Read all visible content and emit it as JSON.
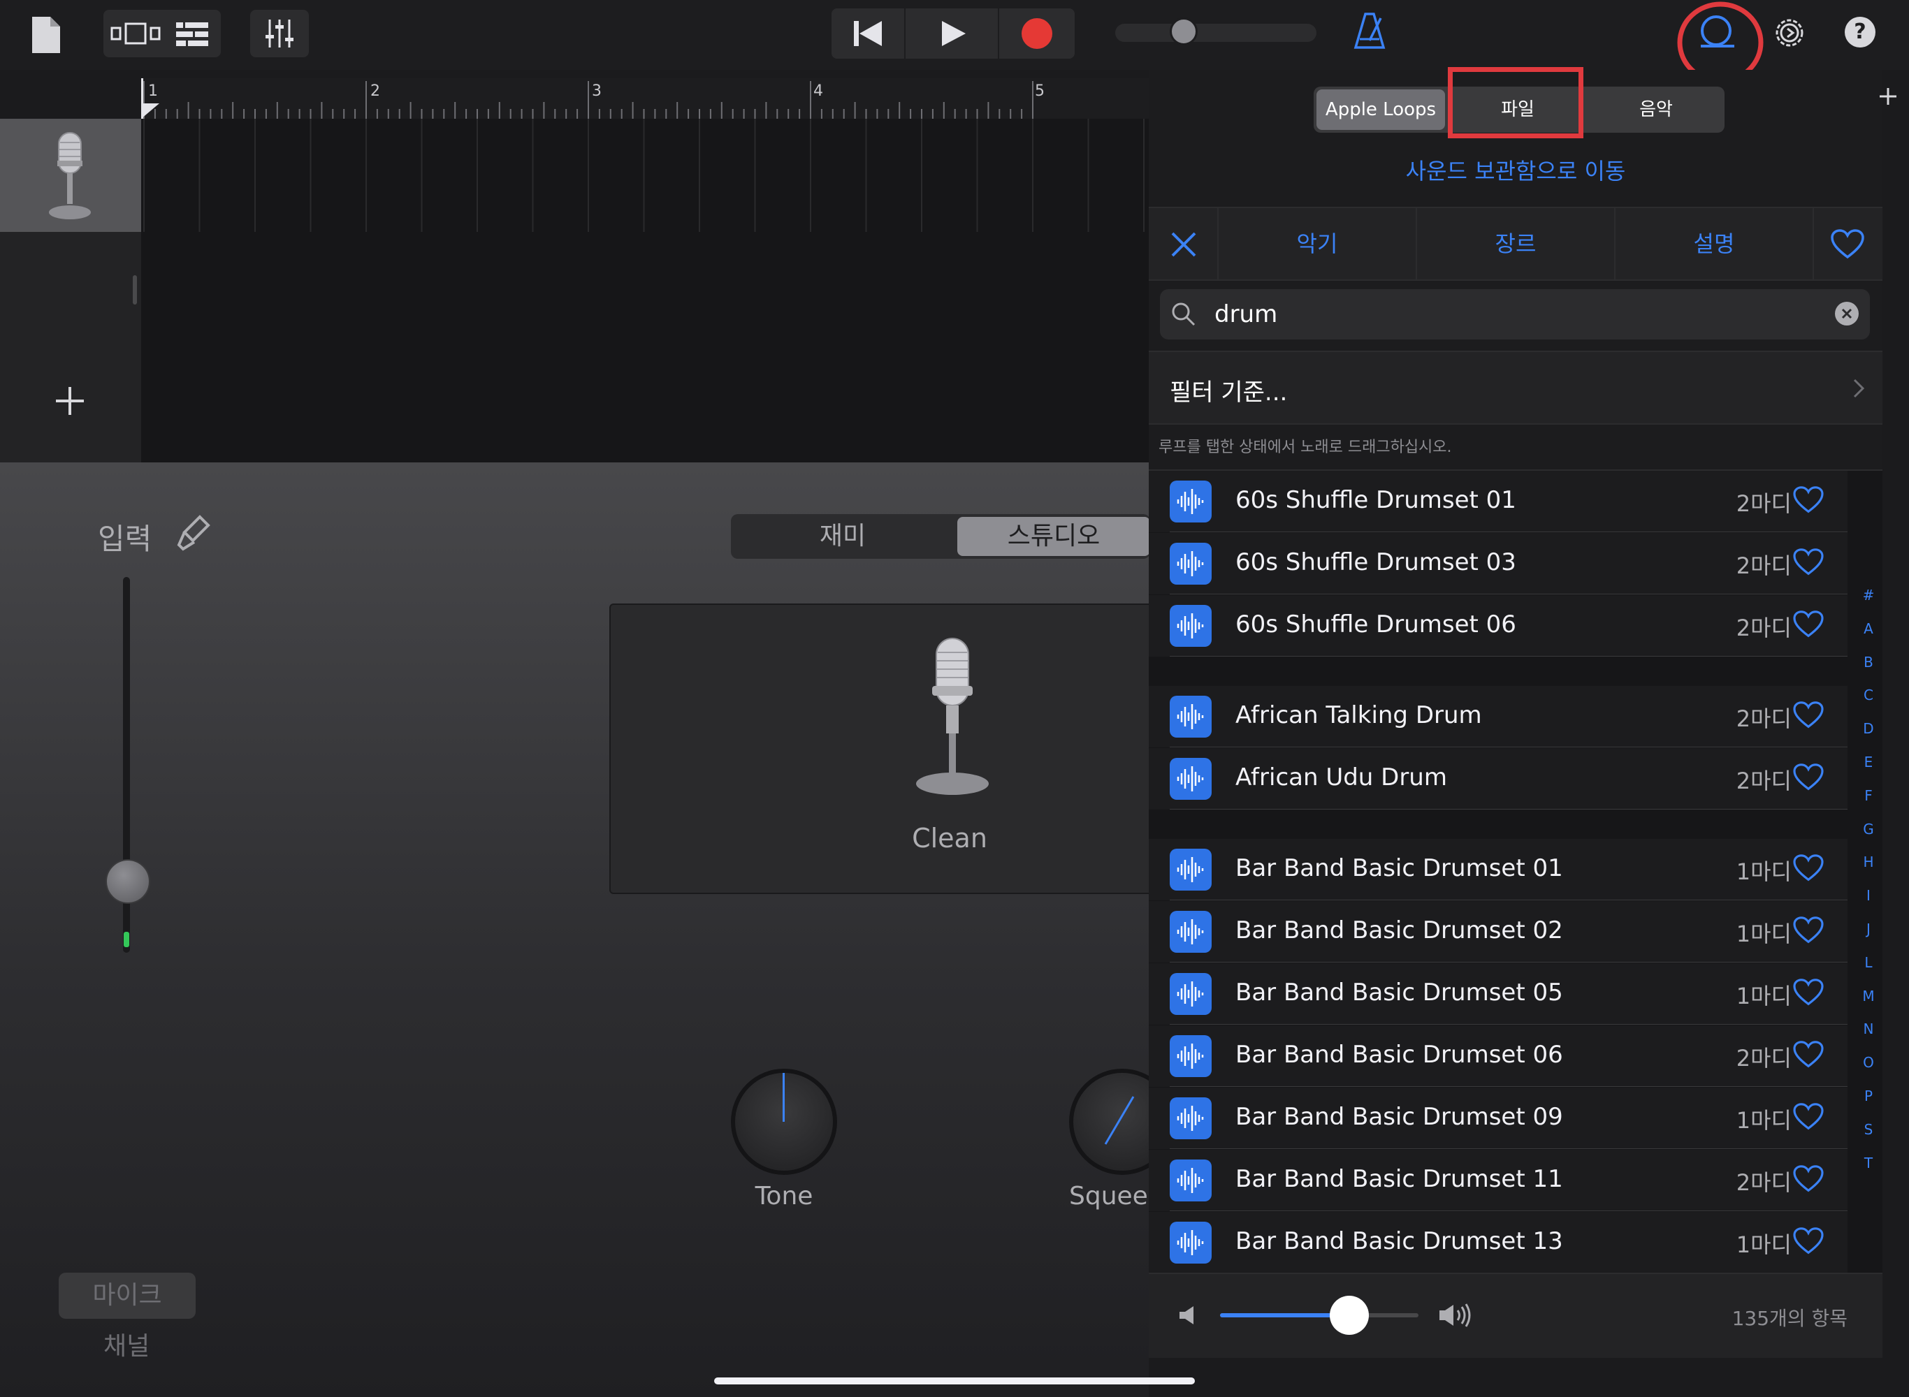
{
  "toolbar": {
    "colors": {
      "accent": "#3b82f6",
      "record": "#e53935",
      "highlight": "#e03a3e"
    }
  },
  "ruler": {
    "marks": [
      "1",
      "2",
      "3",
      "4",
      "5"
    ]
  },
  "instrument": {
    "input_label": "입력",
    "mode_tabs": [
      "재미",
      "스튜디오"
    ],
    "preset_name": "Clean",
    "knob_tone_label": "Tone",
    "knob_squeeze_label": "Squee",
    "mic_label": "마이크",
    "channel_label": "채널"
  },
  "browser": {
    "source_tabs": [
      "Apple Loops",
      "파일",
      "음악"
    ],
    "sound_library_link": "사운드 보관함으로 이동",
    "category_tabs": [
      "악기",
      "장르",
      "설명"
    ],
    "search": {
      "value": "drum"
    },
    "filter_label": "필터 기준...",
    "hint": "루프를 탭한 상태에서 노래로 드래그하십시오.",
    "items": [
      {
        "name": "60s Shuffle Drumset 01",
        "bars": "2마디"
      },
      {
        "name": "60s Shuffle Drumset 03",
        "bars": "2마디"
      },
      {
        "name": "60s Shuffle Drumset 06",
        "bars": "2마디"
      },
      {
        "name": "African Talking Drum",
        "bars": "2마디"
      },
      {
        "name": "African Udu Drum",
        "bars": "2마디"
      },
      {
        "name": "Bar Band Basic Drumset 01",
        "bars": "1마디"
      },
      {
        "name": "Bar Band Basic Drumset 02",
        "bars": "1마디"
      },
      {
        "name": "Bar Band Basic Drumset 05",
        "bars": "1마디"
      },
      {
        "name": "Bar Band Basic Drumset 06",
        "bars": "2마디"
      },
      {
        "name": "Bar Band Basic Drumset 09",
        "bars": "1마디"
      },
      {
        "name": "Bar Band Basic Drumset 11",
        "bars": "2마디"
      },
      {
        "name": "Bar Band Basic Drumset 13",
        "bars": "1마디"
      }
    ],
    "alphabet_index": [
      "#",
      "A",
      "B",
      "C",
      "D",
      "E",
      "F",
      "G",
      "H",
      "I",
      "J",
      "L",
      "M",
      "N",
      "O",
      "P",
      "S",
      "T"
    ],
    "item_count": "135개의 항목",
    "preview_volume": 0.65
  }
}
